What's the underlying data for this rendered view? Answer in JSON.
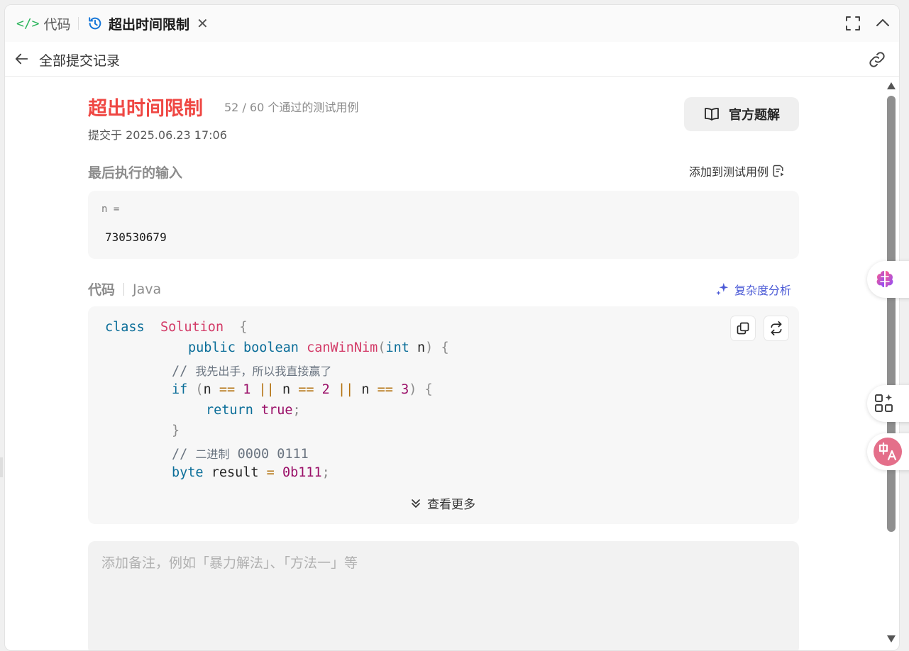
{
  "tabs": {
    "code_label": "代码",
    "code_icon": "</>",
    "result_label": "超出时间限制",
    "close": "✕"
  },
  "header": {
    "back_title": "全部提交记录"
  },
  "submission": {
    "status": "超出时间限制",
    "passed": "52 / 60",
    "passed_suffix": "个通过的测试用例",
    "submitted_at": "提交于 2025.06.23 17:06",
    "official_solution_button": "官方题解",
    "status_color": "#ef4743"
  },
  "last_input": {
    "label": "最后执行的输入",
    "add_to_testcase": "添加到测试用例",
    "var_label": "n =",
    "value": "730530679"
  },
  "code": {
    "label": "代码",
    "language": "Java",
    "complexity_link": "复杂度分析",
    "show_more": "查看更多",
    "lines": [
      {
        "parts": [
          [
            "kw",
            "class"
          ],
          [
            "",
            "  "
          ],
          [
            "cls",
            "Solution"
          ],
          [
            "",
            "  "
          ],
          [
            "pn",
            "{"
          ]
        ]
      },
      {
        "parts": [
          [
            "kw",
            "public"
          ],
          [
            "",
            " "
          ],
          [
            "kw",
            "boolean"
          ],
          [
            "",
            " "
          ],
          [
            "cls",
            "canWinNim"
          ],
          [
            "pn",
            "("
          ],
          [
            "kw",
            "int"
          ],
          [
            "",
            " n"
          ],
          [
            "pn",
            ")"
          ],
          [
            "",
            " "
          ],
          [
            "pn",
            "{"
          ]
        ]
      },
      {
        "parts": [
          [
            "cm",
            "//"
          ],
          [
            "",
            " "
          ],
          [
            "cmcn",
            "我先出手，所以我直接赢了"
          ]
        ]
      },
      {
        "parts": [
          [
            "kw",
            "if"
          ],
          [
            "",
            " "
          ],
          [
            "pn",
            "("
          ],
          [
            "",
            "n "
          ],
          [
            "op",
            "=="
          ],
          [
            "",
            " "
          ],
          [
            "num",
            "1"
          ],
          [
            "",
            " "
          ],
          [
            "op",
            "||"
          ],
          [
            "",
            " n "
          ],
          [
            "op",
            "=="
          ],
          [
            "",
            " "
          ],
          [
            "num",
            "2"
          ],
          [
            "",
            " "
          ],
          [
            "op",
            "||"
          ],
          [
            "",
            " n "
          ],
          [
            "op",
            "=="
          ],
          [
            "",
            " "
          ],
          [
            "num",
            "3"
          ],
          [
            "pn",
            ")"
          ],
          [
            "",
            " "
          ],
          [
            "pn",
            "{"
          ]
        ]
      },
      {
        "parts": [
          [
            "kw",
            "return"
          ],
          [
            "",
            " "
          ],
          [
            "num",
            "true"
          ],
          [
            "pn",
            ";"
          ]
        ]
      },
      {
        "parts": [
          [
            "pn",
            "}"
          ]
        ]
      },
      {
        "parts": [
          [
            "cm",
            "//"
          ],
          [
            "",
            " "
          ],
          [
            "cmcn",
            "二进制"
          ],
          [
            "",
            " "
          ],
          [
            "cm",
            "0000 0111"
          ]
        ]
      },
      {
        "parts": [
          [
            "kw",
            "byte"
          ],
          [
            "",
            " result "
          ],
          [
            "op",
            "="
          ],
          [
            "",
            " "
          ],
          [
            "num",
            "0b111"
          ],
          [
            "pn",
            ";"
          ]
        ]
      }
    ]
  },
  "notes": {
    "placeholder": "添加备注，例如「暴力解法」、「方法一」等"
  },
  "icons": {
    "fullscreen": "fullscreen-icon",
    "collapse": "chevron-up-icon",
    "back": "arrow-left-icon",
    "share": "link-icon",
    "book": "book-icon",
    "add_case": "file-play-icon",
    "sparkle": "sparkle-icon",
    "copy": "copy-icon",
    "swap": "swap-icon",
    "brain": "brain-icon",
    "apps": "apps-sparkle-icon",
    "translate": "translate-icon"
  },
  "colors": {
    "accent_blue": "#4b5ad6",
    "code_bg": "#f7f7f7",
    "keyword": "#0b6e99",
    "class_name": "#d33a67"
  }
}
